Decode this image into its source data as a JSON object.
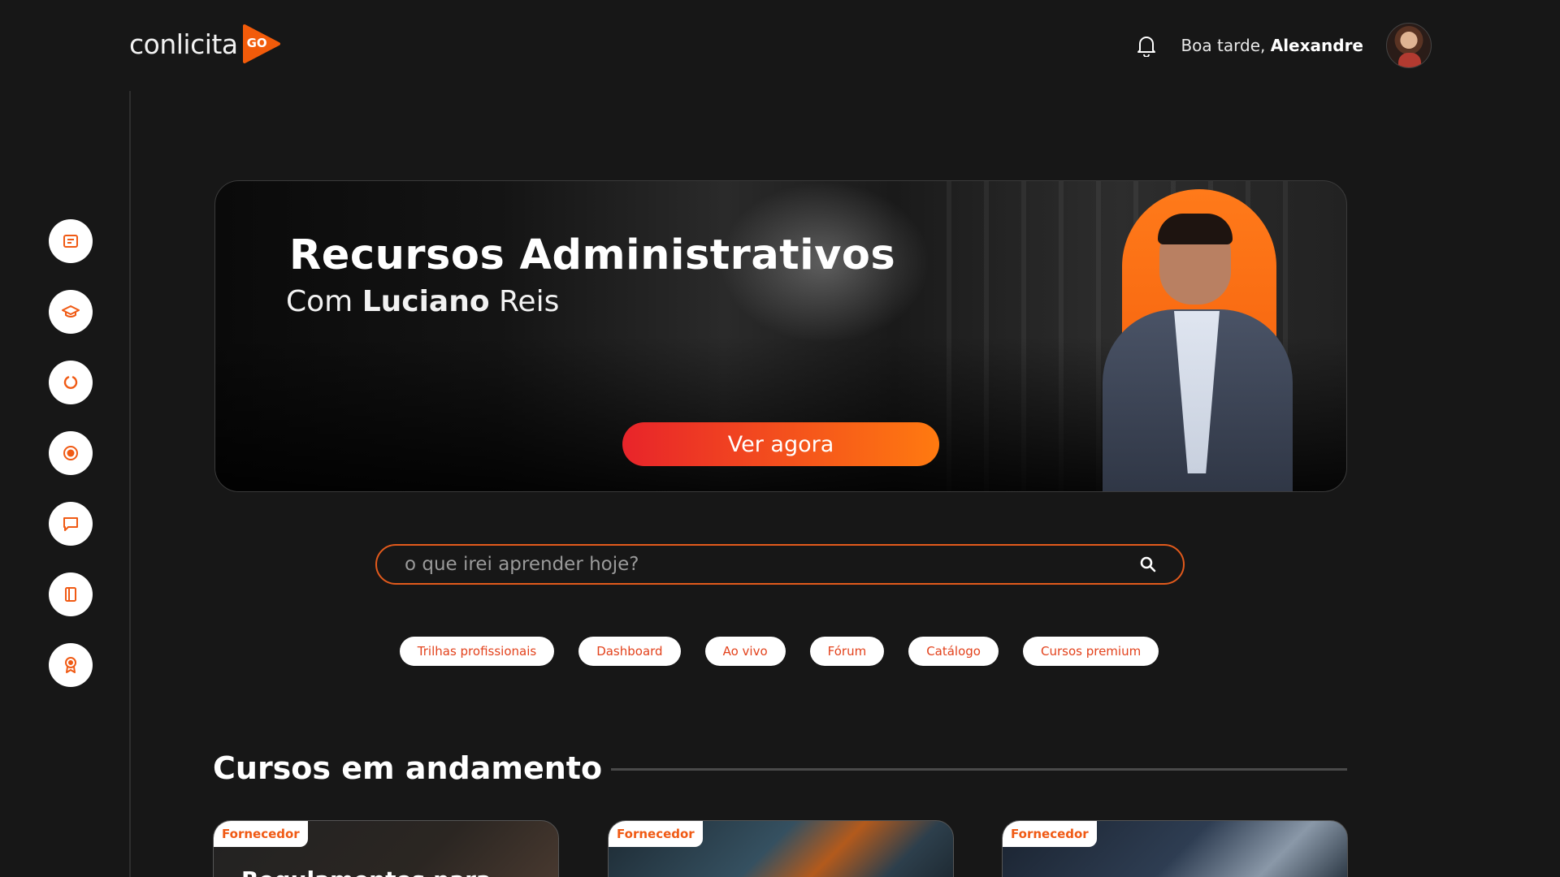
{
  "header": {
    "logo_text": "conlicita",
    "logo_badge": "GO",
    "greeting_prefix": "Boa tarde,",
    "user_name": "Alexandre"
  },
  "sidebar": {
    "items": [
      {
        "icon": "notes-icon"
      },
      {
        "icon": "graduation-cap-icon"
      },
      {
        "icon": "loading-ring-icon"
      },
      {
        "icon": "live-record-icon"
      },
      {
        "icon": "chat-bubble-icon"
      },
      {
        "icon": "book-icon"
      },
      {
        "icon": "certificate-icon"
      }
    ]
  },
  "hero": {
    "title": "Recursos Administrativos",
    "subtitle_prefix": "Com ",
    "subtitle_name": "Luciano",
    "subtitle_suffix": " Reis",
    "cta_label": "Ver agora"
  },
  "search": {
    "placeholder": "o que irei aprender hoje?",
    "value": ""
  },
  "chips": [
    "Trilhas profissionais",
    "Dashboard",
    "Ao vivo",
    "Fórum",
    "Catálogo",
    "Cursos premium"
  ],
  "section": {
    "title": "Cursos em andamento"
  },
  "cards": [
    {
      "badge": "Fornecedor",
      "title": "Regulamentos para"
    },
    {
      "badge": "Fornecedor",
      "title": ""
    },
    {
      "badge": "Fornecedor",
      "title": ""
    }
  ],
  "colors": {
    "accent": "#f25b0a",
    "accent_red": "#e8242a",
    "background": "#171717"
  }
}
